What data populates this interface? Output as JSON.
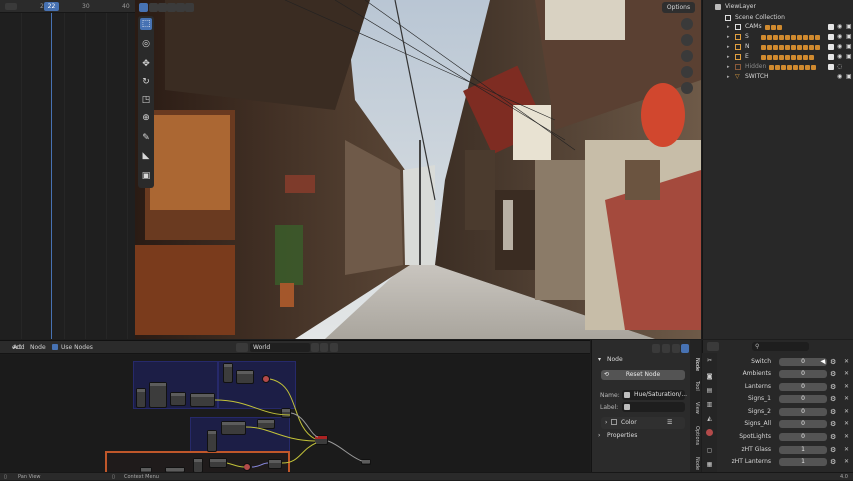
{
  "timeline": {
    "ticks": [
      "20",
      "30",
      "40"
    ],
    "current_frame": "22"
  },
  "viewport": {
    "options_label": "Options"
  },
  "outliner": {
    "view_layer": "ViewLayer",
    "scene_collection": "Scene Collection",
    "items": [
      {
        "label": "CAMs"
      },
      {
        "label": "S"
      },
      {
        "label": "N"
      },
      {
        "label": "E"
      },
      {
        "label": "Hidden"
      },
      {
        "label": "SWITCH"
      }
    ]
  },
  "node_editor": {
    "menu": [
      "ect",
      "Add",
      "Node"
    ],
    "use_nodes_label": "Use Nodes",
    "world_label": "World"
  },
  "properties": {
    "section_node": "Node",
    "reset_node_label": "Reset Node",
    "name_label": "Name:",
    "name_value": "Hue/Saturation/...",
    "label_label": "Label:",
    "color_label": "Color",
    "properties_label": "Properties",
    "tabs": [
      "Node",
      "Tool",
      "View",
      "Options",
      "Node"
    ]
  },
  "driver": {
    "rows": [
      {
        "label": "Switch",
        "value": "0"
      },
      {
        "label": "Ambients",
        "value": "0"
      },
      {
        "label": "Lanterns",
        "value": "0"
      },
      {
        "label": "Signs_1",
        "value": "0"
      },
      {
        "label": "Signs_2",
        "value": "0"
      },
      {
        "label": "Signs_All",
        "value": "0"
      },
      {
        "label": "SpotLights",
        "value": "0"
      },
      {
        "label": "zHT Glass",
        "value": "1"
      },
      {
        "label": "zHT Lanterns",
        "value": "1"
      }
    ]
  },
  "status": {
    "left": "Pan View",
    "middle": "Context Menu",
    "version": "4.0"
  }
}
